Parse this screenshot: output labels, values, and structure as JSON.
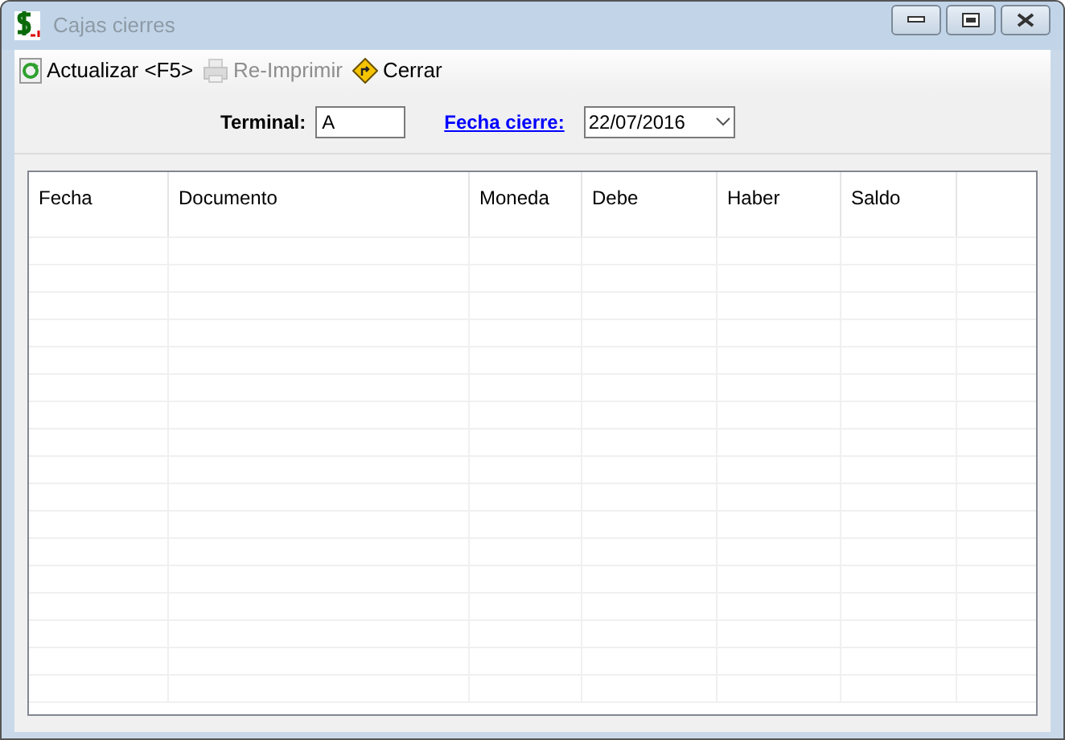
{
  "window": {
    "title": "Cajas cierres"
  },
  "toolbar": [
    {
      "kind": "refresh",
      "label": "Actualizar <F5>",
      "disabled": false
    },
    {
      "kind": "print",
      "label": "Re-Imprimir",
      "disabled": true
    },
    {
      "kind": "close",
      "label": "Cerrar",
      "disabled": false
    }
  ],
  "filters": {
    "terminal": {
      "label": "Terminal:",
      "value": "A"
    },
    "fecha_cierre": {
      "label": "Fecha cierre:",
      "value": "22/07/2016"
    }
  },
  "table": {
    "columns": [
      "Fecha",
      "Documento",
      "Moneda",
      "Debe",
      "Haber",
      "Saldo"
    ]
  }
}
